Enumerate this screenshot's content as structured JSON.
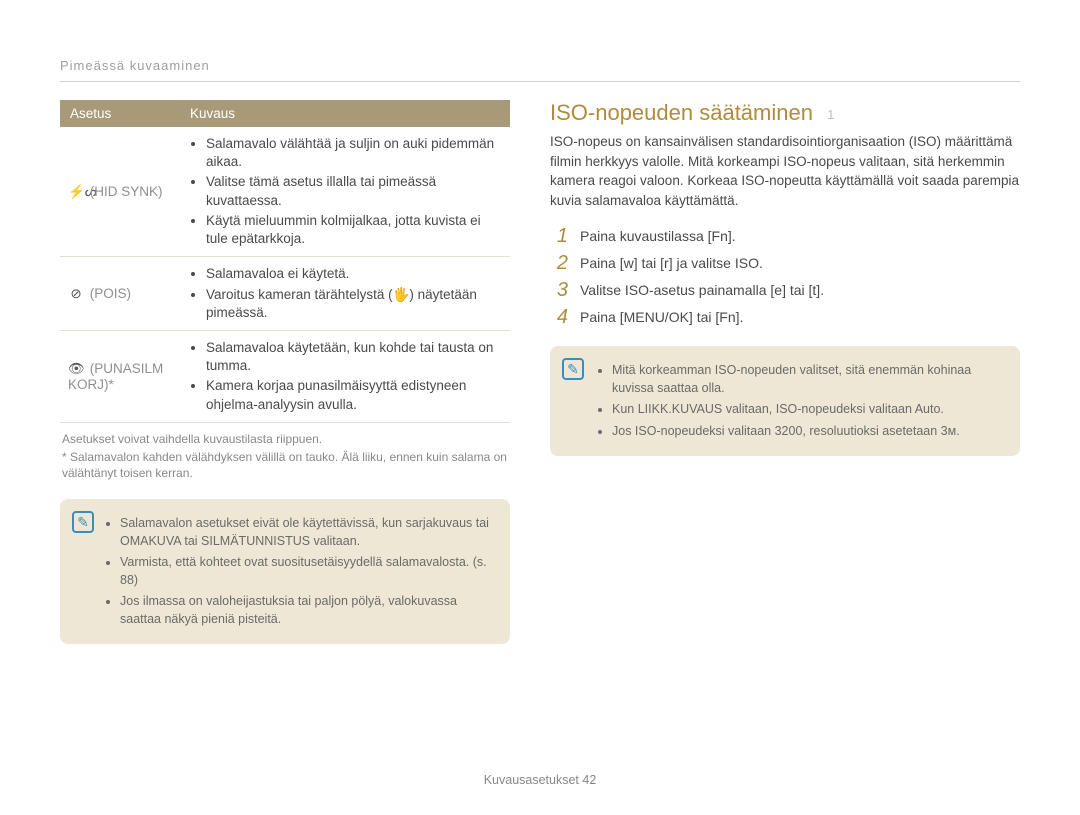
{
  "header": "Pimeässä kuvaaminen",
  "table": {
    "col1": "Asetus",
    "col2": "Kuvaus",
    "rows": [
      {
        "label_prefix": "⚡ᔕ",
        "label": "(HID SYNK)",
        "items": [
          "Salamavalo välähtää ja suljin on auki pidemmän aikaa.",
          "Valitse tämä asetus illalla tai pimeässä kuvattaessa.",
          "Käytä mieluummin kolmijalkaa, jotta kuvista ei tule epätarkkoja."
        ]
      },
      {
        "label_prefix": "⊘",
        "label": "(POIS)",
        "items": [
          "Salamavaloa ei käytetä.",
          "Varoitus kameran tärähtelystä (🖐) näytetään pimeässä."
        ]
      },
      {
        "label_prefix": "👁",
        "label": "(PUNASILM KORJ)*",
        "items": [
          "Salamavaloa käytetään, kun kohde tai tausta on tumma.",
          "Kamera korjaa punasilmäisyyttä edistyneen ohjelma-analyysin avulla."
        ]
      }
    ]
  },
  "footnotes": [
    "Asetukset voivat vaihdella kuvaustilasta riippuen.",
    "* Salamavalon kahden välähdyksen välillä on tauko. Älä liiku, ennen kuin salama on välähtänyt toisen kerran."
  ],
  "tip_left": [
    "Salamavalon asetukset eivät ole käytettävissä, kun sarjakuvaus tai OMAKUVA tai SILMÄTUNNISTUS valitaan.",
    "Varmista, että kohteet ovat suositusetäisyydellä salamavalosta. (s. 88)",
    "Jos ilmassa on valoheijastuksia tai paljon pölyä, valokuvassa saattaa näkyä pieniä pisteitä."
  ],
  "right": {
    "heading": "ISO-nopeuden säätäminen",
    "sub": "1",
    "intro": "ISO-nopeus on kansainvälisen standardisointiorganisaation (ISO) määrittämä filmin herkkyys valolle. Mitä korkeampi ISO-nopeus valitaan, sitä herkemmin kamera reagoi valoon. Korkeaa ISO-nopeutta käyttämällä voit saada parempia kuvia salamavaloa käyttämättä.",
    "steps": [
      "Paina kuvaustilassa [Fn].",
      "Paina [w] tai [r] ja valitse ISO.",
      "Valitse ISO-asetus painamalla [e] tai [t].",
      "Paina [MENU/OK] tai [Fn]."
    ],
    "tips": [
      "Mitä korkeamman ISO-nopeuden valitset, sitä enemmän kohinaa kuvissa saattaa olla.",
      "Kun LIIKK.KUVAUS valitaan, ISO-nopeudeksi valitaan Auto.",
      "Jos ISO-nopeudeksi valitaan 3200, resoluutioksi asetetaan 3ᴍ."
    ]
  },
  "footer": "Kuvausasetukset 42"
}
